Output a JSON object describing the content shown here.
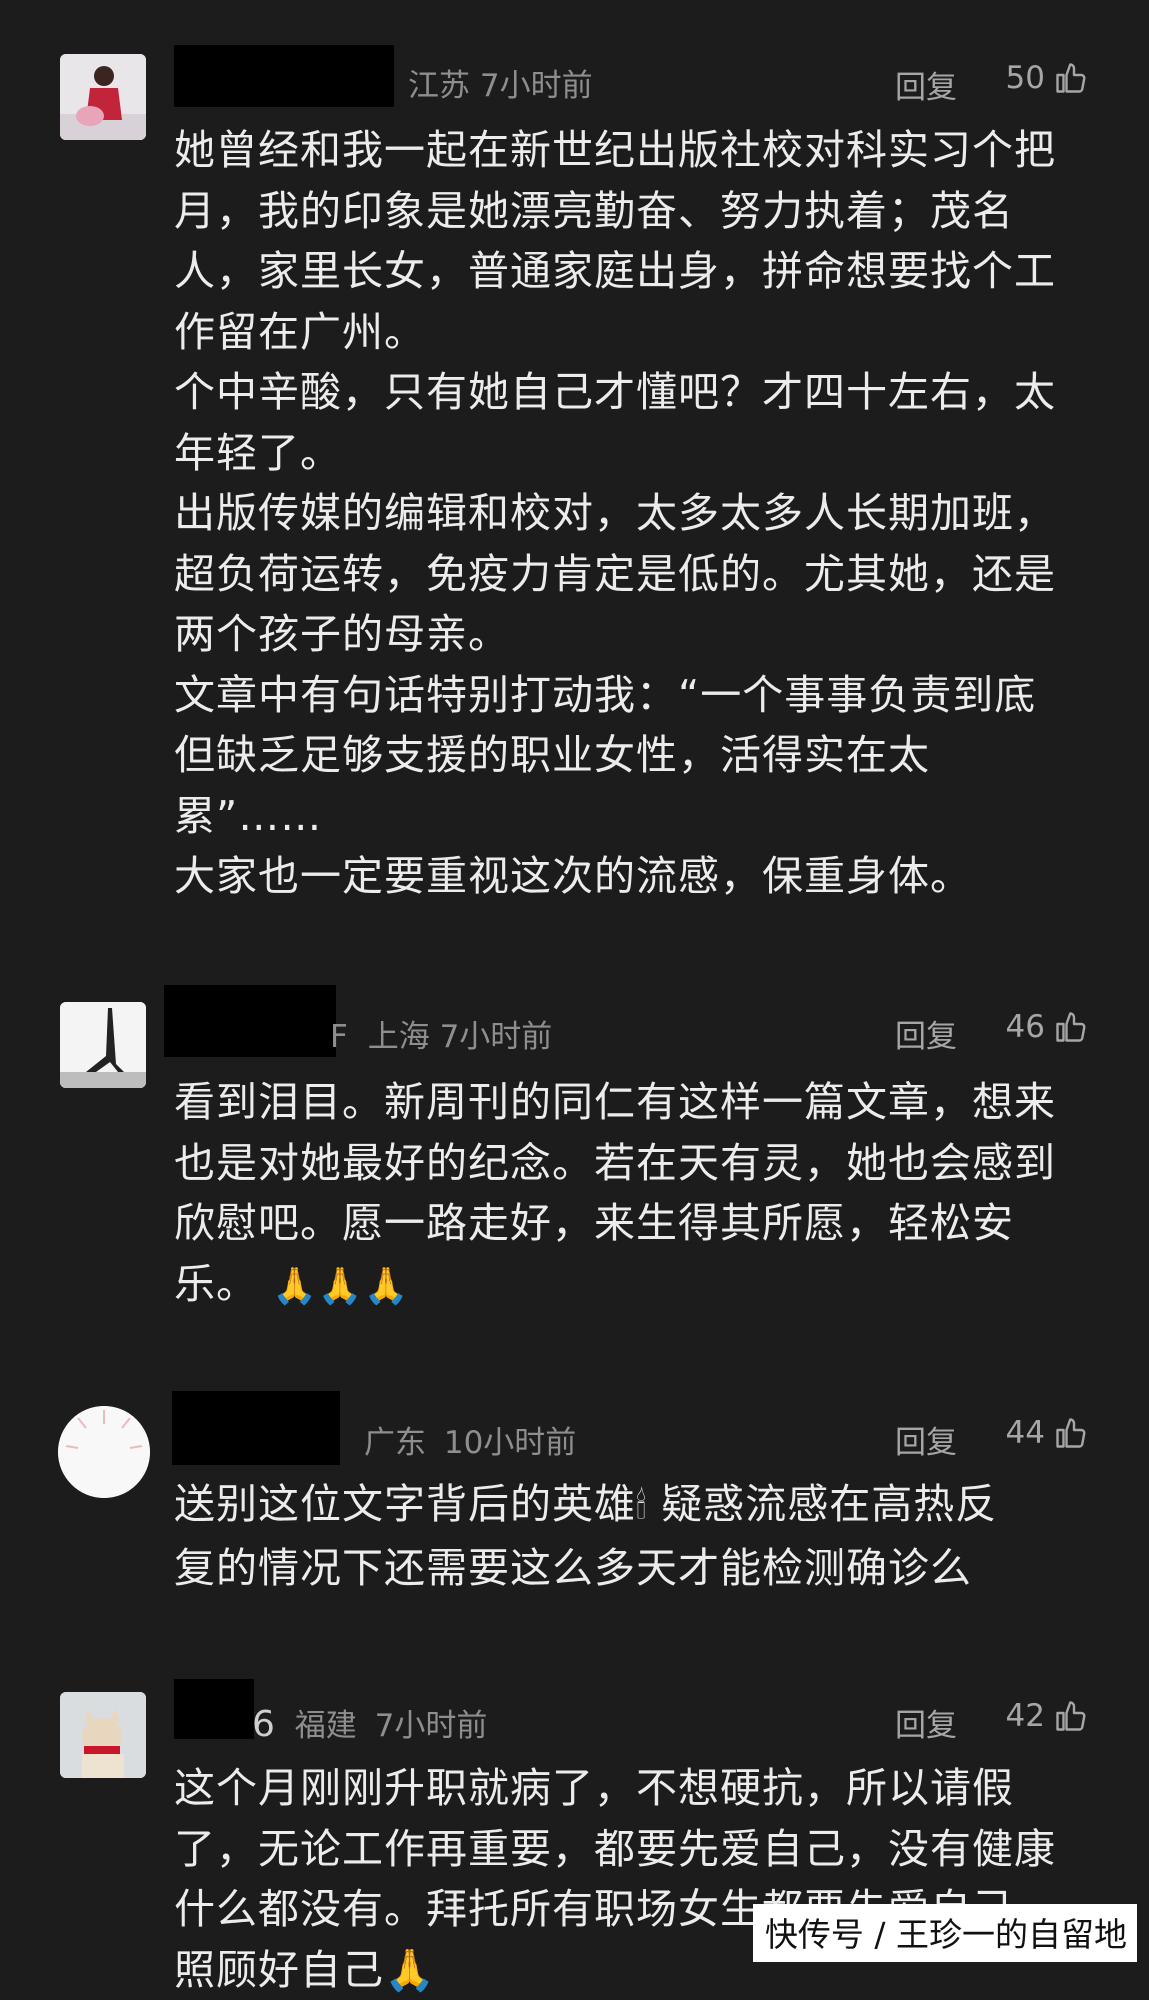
{
  "comments": [
    {
      "username_tail": "",
      "location": "江苏",
      "time": "7小时前",
      "reply_label": "回复",
      "likes": "50",
      "text": "她曾经和我一起在新世纪出版社校对科实习个把\n月，我的印象是她漂亮勤奋、努力执着；茂名\n人，家里长女，普通家庭出身，拼命想要找个工\n作留在广州。\n个中辛酸，只有她自己才懂吧？才四十左右，太\n年轻了。\n出版传媒的编辑和校对，太多太多人长期加班，\n超负荷运转，免疫力肯定是低的。尤其她，还是\n两个孩子的母亲。\n文章中有句话特别打动我：“一个事事负责到底\n但缺乏足够支援的职业女性，活得实在太\n累”……\n大家也一定要重视这次的流感，保重身体。"
    },
    {
      "username_tail": "F",
      "location": "上海",
      "time": "7小时前",
      "reply_label": "回复",
      "likes": "46",
      "text": "看到泪目。新周刊的同仁有这样一篇文章，想来\n也是对她最好的纪念。若在天有灵，她也会感到\n欣慰吧。愿一路走好，来生得其所愿，轻松安\n乐。",
      "emoji": "🙏🙏🙏"
    },
    {
      "username_tail": "",
      "location": "广东",
      "time": "10小时前",
      "reply_label": "回复",
      "likes": "44",
      "text_a": "送别这位文字背后的英雄",
      "emoji": "🕯",
      "text_b": " 疑惑流感在高热反\n复的情况下还需要这么多天才能检测确诊么"
    },
    {
      "username_tail": "6",
      "location": "福建",
      "time": "7小时前",
      "reply_label": "回复",
      "likes": "42",
      "text": "这个月刚刚升职就病了，不想硬抗，所以请假\n了，无论工作再重要，都要先爱自己，没有健康\n什么都没有。拜托所有职场女生都要先爱自己，\n照顾好自己🙏"
    }
  ],
  "watermark": "快传号 / 王珍一的自留地",
  "icons": {
    "like": "thumbs-up-icon"
  }
}
